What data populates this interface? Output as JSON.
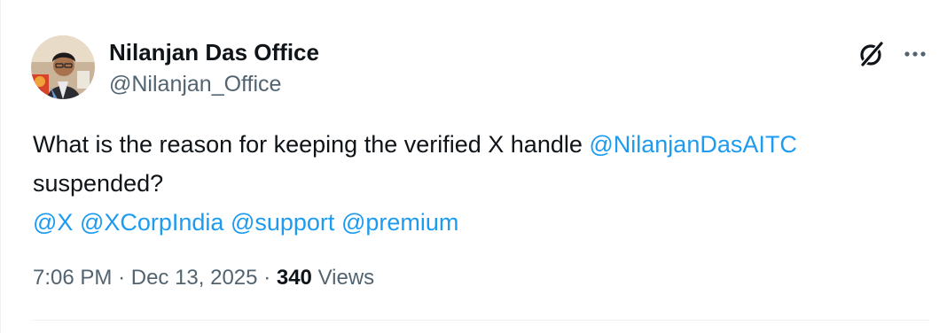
{
  "author": {
    "name": "Nilanjan Das Office",
    "handle": "@Nilanjan_Office"
  },
  "tweet": {
    "text_before": "What is the reason for keeping the verified X handle ",
    "mention_main": "@NilanjanDasAITC",
    "text_after": "suspended?",
    "mentions": [
      "@X",
      "@XCorpIndia",
      "@support",
      "@premium"
    ]
  },
  "meta": {
    "time": "7:06 PM",
    "separator": "·",
    "date": "Dec 13, 2025",
    "views_count": "340",
    "views_label": "Views"
  },
  "icons": {
    "grok": "grok-icon",
    "more": "more-icon",
    "avatar": "avatar"
  },
  "colors": {
    "link": "#1d9bf0",
    "secondary_text": "#536471",
    "primary_text": "#0f1419"
  }
}
